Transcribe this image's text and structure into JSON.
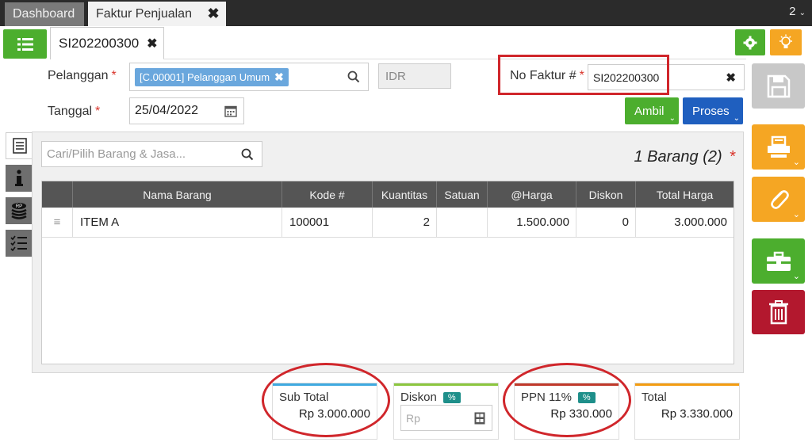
{
  "tabs": {
    "dashboard": "Dashboard",
    "faktur": "Faktur Penjualan",
    "close": "✖",
    "count": "2"
  },
  "doc_tab": {
    "label": "SI202200300",
    "close": "✖"
  },
  "form": {
    "pelanggan_label": "Pelanggan",
    "pelanggan_value": "[C.00001] Pelanggan Umum",
    "currency": "IDR",
    "tanggal_label": "Tanggal",
    "tanggal_value": "25/04/2022",
    "no_faktur_label": "No Faktur #",
    "no_faktur_value": "SI202200300",
    "required_mark": "*"
  },
  "actions": {
    "ambil": "Ambil",
    "proses": "Proses"
  },
  "search": {
    "placeholder": "Cari/Pilih Barang & Jasa..."
  },
  "item_count": "1 Barang (2)",
  "table": {
    "headers": [
      "Nama Barang",
      "Kode #",
      "Kuantitas",
      "Satuan",
      "@Harga",
      "Diskon",
      "Total Harga"
    ],
    "rows": [
      {
        "drag": "≡",
        "nama": "ITEM A",
        "kode": "100001",
        "kuantitas": "2",
        "satuan": "",
        "harga": "1.500.000",
        "diskon": "0",
        "total": "3.000.000"
      }
    ]
  },
  "summary": {
    "subtotal_label": "Sub Total",
    "subtotal_value": "Rp 3.000.000",
    "diskon_label": "Diskon",
    "diskon_pct": "%",
    "diskon_placeholder": "Rp",
    "ppn_label": "PPN 11%",
    "ppn_pct": "%",
    "ppn_value": "Rp 330.000",
    "total_label": "Total",
    "total_value": "Rp 3.330.000"
  },
  "colors": {
    "green": "#4cae2e",
    "orange": "#f5a623",
    "blue": "#1f5fbf",
    "red_highlight": "#d0262b",
    "dark_red": "#b3182e",
    "teal": "#1e8f8a"
  }
}
